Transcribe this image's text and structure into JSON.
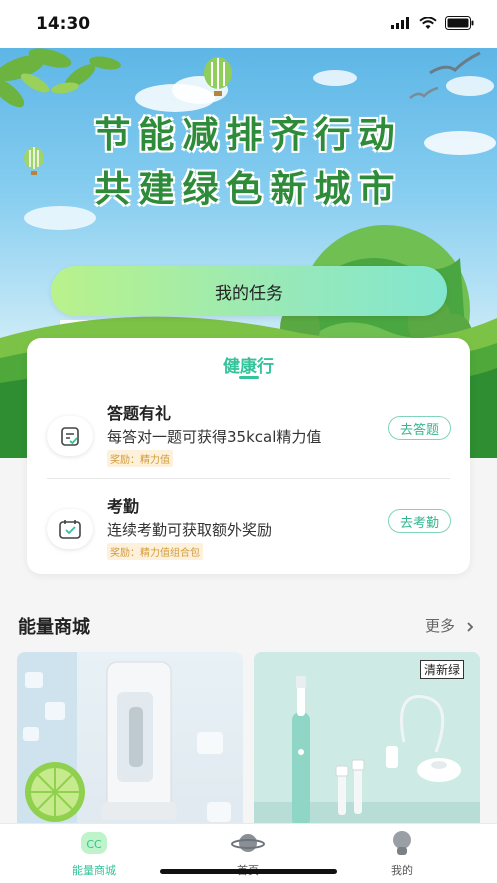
{
  "status": {
    "time": "14:30"
  },
  "hero": {
    "title_line1": "节能减排齐行动",
    "title_line2": "共建绿色新城市",
    "task_button": "我的任务"
  },
  "health": {
    "title": "健康行",
    "tasks": [
      {
        "name": "答题有礼",
        "desc": "每答对一题可获得35kcal精力值",
        "reward": "奖励：精力值",
        "action": "去答题",
        "icon": "quiz-icon"
      },
      {
        "name": "考勤",
        "desc": "连续考勤可获取额外奖励",
        "reward": "奖励：精力值组合包",
        "action": "去考勤",
        "icon": "calendar-check-icon"
      }
    ]
  },
  "mall": {
    "title": "能量商城",
    "more": "更多",
    "products": [
      {
        "tag": ""
      },
      {
        "tag": "清新绿"
      }
    ]
  },
  "tabbar": {
    "tabs": [
      {
        "label": "能量商城",
        "active": true
      },
      {
        "label": "首页",
        "active": false
      },
      {
        "label": "我的",
        "active": false
      }
    ]
  },
  "colors": {
    "accent": "#34c39a",
    "title_green": "#2e8b3a",
    "reward": "#d19a3a"
  }
}
